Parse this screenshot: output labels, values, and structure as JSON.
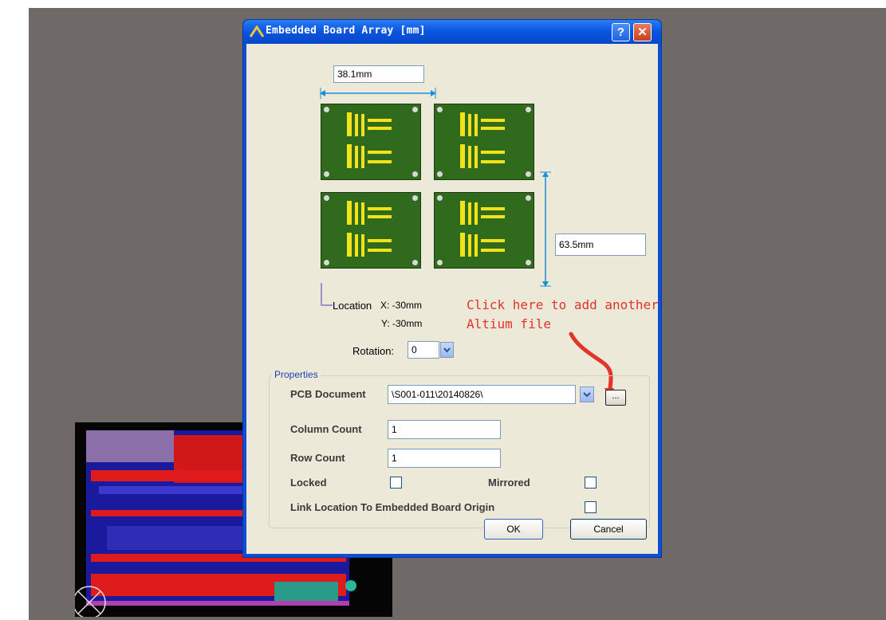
{
  "dialog": {
    "title": "Embedded Board Array [mm]",
    "help_label": "?",
    "close_label": "✕",
    "width_dimension": "38.1mm",
    "height_dimension": "63.5mm",
    "location_label": "Location",
    "location_x": "X: -30mm",
    "location_y": "Y: -30mm",
    "rotation_label": "Rotation:",
    "rotation_value": "0",
    "properties": {
      "group_label": "Properties",
      "pcb_document_label": "PCB Document",
      "pcb_document_value": "\\S001-011\\20140826\\",
      "browse_label": "...",
      "column_count_label": "Column Count",
      "column_count_value": "1",
      "row_count_label": "Row Count",
      "row_count_value": "1",
      "locked_label": "Locked",
      "mirrored_label": "Mirrored",
      "link_location_label": "Link Location To Embedded Board Origin"
    },
    "ok_label": "OK",
    "cancel_label": "Cancel"
  },
  "annotation": {
    "line1": "Click here to add another",
    "line2": "Altium file"
  },
  "colors": {
    "workspace_bg": "#6f6a68",
    "dialog_face": "#ece9d8",
    "annotation_red": "#e0342c",
    "board_green": "#2f6a1d",
    "dimension_blue": "#1a8fd6"
  }
}
